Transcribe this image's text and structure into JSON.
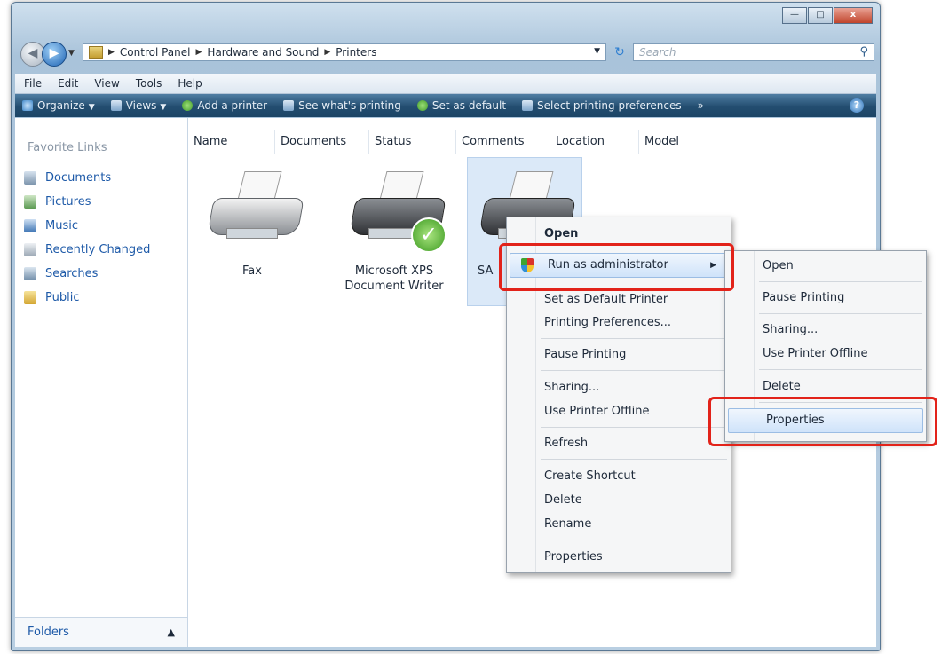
{
  "window": {
    "controls": [
      "—",
      "□",
      "x"
    ]
  },
  "navigation": {
    "back_icon": "back-arrow-icon",
    "forward_icon": "forward-arrow-icon",
    "breadcrumbs": [
      "Control Panel",
      "Hardware and Sound",
      "Printers"
    ],
    "search_placeholder": "Search"
  },
  "menubar": [
    "File",
    "Edit",
    "View",
    "Tools",
    "Help"
  ],
  "toolbar": {
    "items": [
      "Organize",
      "Views",
      "Add a printer",
      "See what's printing",
      "Set as default",
      "Select printing preferences"
    ],
    "overflow": "»",
    "help": "?"
  },
  "sidebar": {
    "title": "Favorite Links",
    "items": [
      "Documents",
      "Pictures",
      "Music",
      "Recently Changed",
      "Searches",
      "Public"
    ],
    "folders_label": "Folders"
  },
  "columns": [
    "Name",
    "Documents",
    "Status",
    "Comments",
    "Location",
    "Model"
  ],
  "printers": [
    {
      "name": "Fax",
      "default": false
    },
    {
      "name": "Microsoft XPS Document Writer",
      "default": true
    },
    {
      "name": "SA",
      "default": false,
      "selected": true
    }
  ],
  "context_menu": {
    "items": [
      "Open",
      "Run as administrator",
      "Set as Default Printer",
      "Printing Preferences...",
      "Pause Printing",
      "Sharing...",
      "Use Printer Offline",
      "Refresh",
      "Create Shortcut",
      "Delete",
      "Rename",
      "Properties"
    ]
  },
  "submenu": {
    "items": [
      "Open",
      "Pause Printing",
      "Sharing...",
      "Use Printer Offline",
      "Delete",
      "Properties"
    ]
  },
  "colors": {
    "highlight_box": "#e2231a",
    "toolbar": "#234d70",
    "link": "#1e5aa8"
  }
}
